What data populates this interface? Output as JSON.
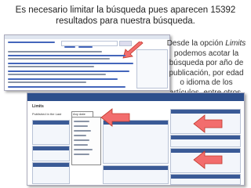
{
  "heading": "Es necesario limitar la búsqueda pues aparecen 15392 resultados para nuestra búsqueda.",
  "note": {
    "prefix": "Desde la opción ",
    "emph": "Limits",
    "suffix": " podemos acotar la búsqueda por año de publicación, por edad o idioma de los artículos, entre otros."
  },
  "limits_page": {
    "title": "Limits",
    "field_label": "Published in the Last",
    "field_value": "Any date"
  },
  "colors": {
    "arrow_fill": "#f26d6d",
    "arrow_stroke": "#c0392b",
    "header_blue": "#3a5a96"
  }
}
